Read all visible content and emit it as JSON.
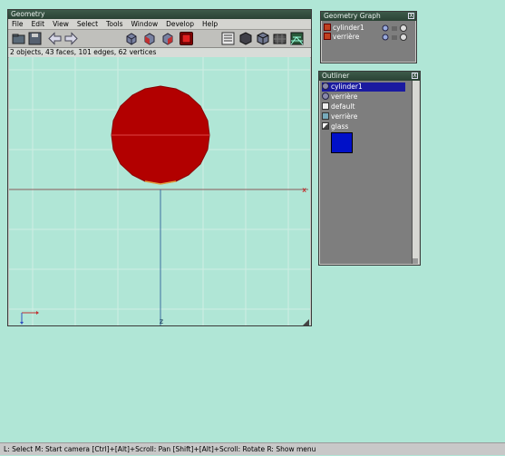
{
  "geometry_window": {
    "title": "Geometry",
    "menu": [
      "File",
      "Edit",
      "View",
      "Select",
      "Tools",
      "Window",
      "Develop",
      "Help"
    ],
    "status": "2 objects, 43 faces, 101 edges, 62 vertices",
    "axis_x_label": "x",
    "axis_z_label": "z"
  },
  "geometry_graph": {
    "title": "Geometry Graph",
    "close": "X",
    "items": [
      {
        "label": "cylinder1"
      },
      {
        "label": "verrière"
      }
    ]
  },
  "outliner": {
    "title": "Outliner",
    "close": "X",
    "items": [
      {
        "label": "cylinder1",
        "icon": "object-icon",
        "selected": true
      },
      {
        "label": "verrière",
        "icon": "object-icon",
        "selected": false
      },
      {
        "label": "default",
        "icon": "material-icon",
        "selected": false
      },
      {
        "label": "verrière",
        "icon": "material-icon",
        "selected": false
      },
      {
        "label": "glass",
        "icon": "image-icon",
        "selected": false
      }
    ],
    "swatch_color": "#0010c8"
  },
  "shape_color": "#b00000",
  "hint_bar": "L: Select   M: Start camera   [Ctrl]+[Alt]+Scroll: Pan   [Shift]+[Alt]+Scroll: Rotate   R: Show menu"
}
